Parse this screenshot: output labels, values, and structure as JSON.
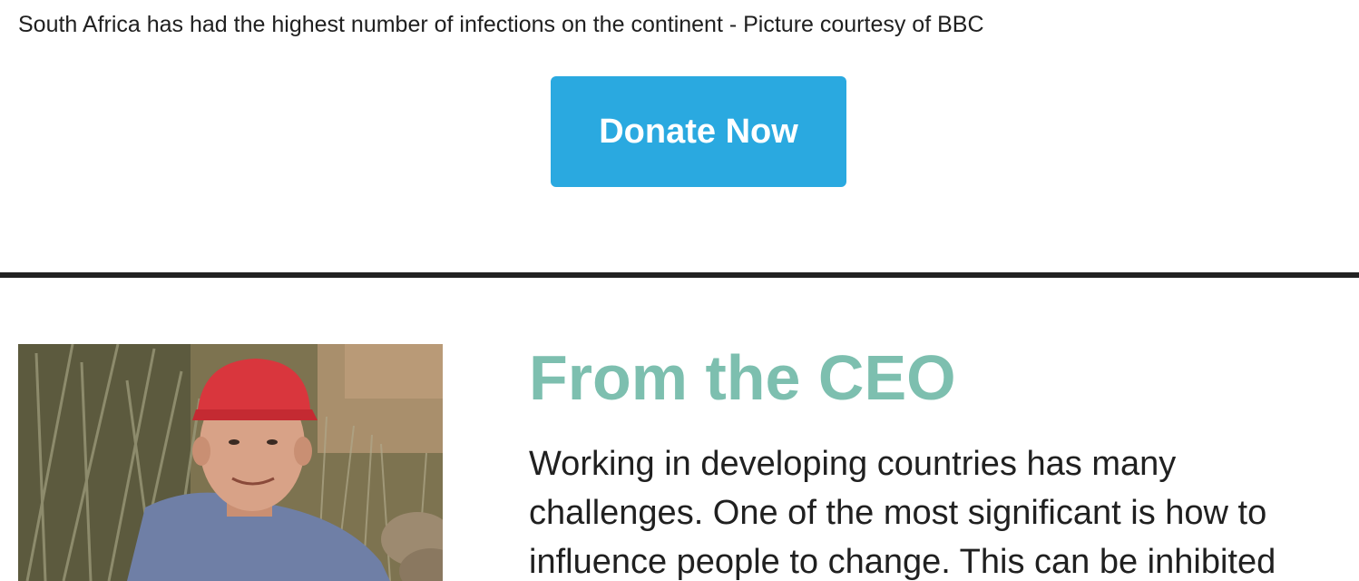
{
  "caption": "South Africa has had the highest number of infections on the continent - Picture courtesy of BBC",
  "donate_button": {
    "label": "Donate Now",
    "color": "#2aa9e0"
  },
  "ceo_section": {
    "heading": "From the CEO",
    "heading_color": "#7dbfaf",
    "body_lines": [
      "Working in developing countries has many",
      "challenges. One of the most significant is how to",
      "influence people to change. This can be inhibited"
    ]
  }
}
